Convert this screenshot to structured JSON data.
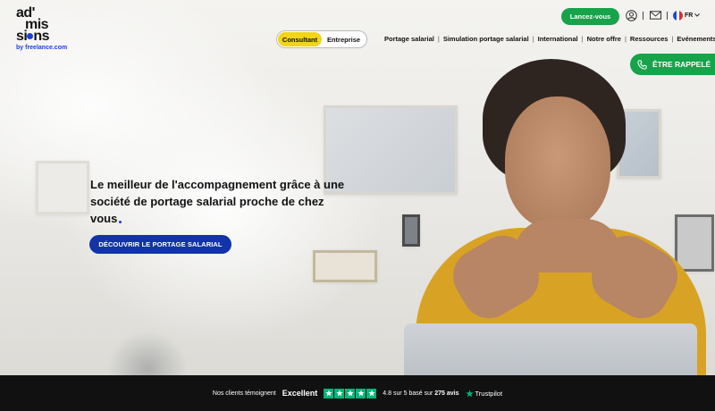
{
  "logo": {
    "line1": "ad'",
    "line2": "mis",
    "line3_a": "si",
    "line3_b": "ns",
    "subtitle": "by freelance.com"
  },
  "toggle": {
    "options": [
      "Consultant",
      "Entreprise"
    ],
    "active": "Consultant"
  },
  "nav": {
    "items": [
      "Portage salarial",
      "Simulation portage salarial",
      "International",
      "Notre offre",
      "Ressources",
      "Evénements"
    ]
  },
  "header": {
    "launch_label": "Lancez-vous",
    "lang": "FR"
  },
  "callback": {
    "label": "ÊTRE RAPPELÉ"
  },
  "hero": {
    "headline": "Le meilleur de l'accompagnement grâce à une société de portage salarial proche de chez vous",
    "cta_label": "DÉCOUVRIR LE PORTAGE SALARIAL"
  },
  "trust": {
    "intro": "Nos clients témoignent",
    "verdict": "Excellent",
    "rating_prefix": "4.8 sur 5 basé sur",
    "reviews": "275 avis",
    "brand": "Trustpilot"
  },
  "colors": {
    "green": "#16a34a",
    "blue": "#1234a8",
    "yellow": "#f1d51b",
    "trustpilot_green": "#00b67a"
  }
}
